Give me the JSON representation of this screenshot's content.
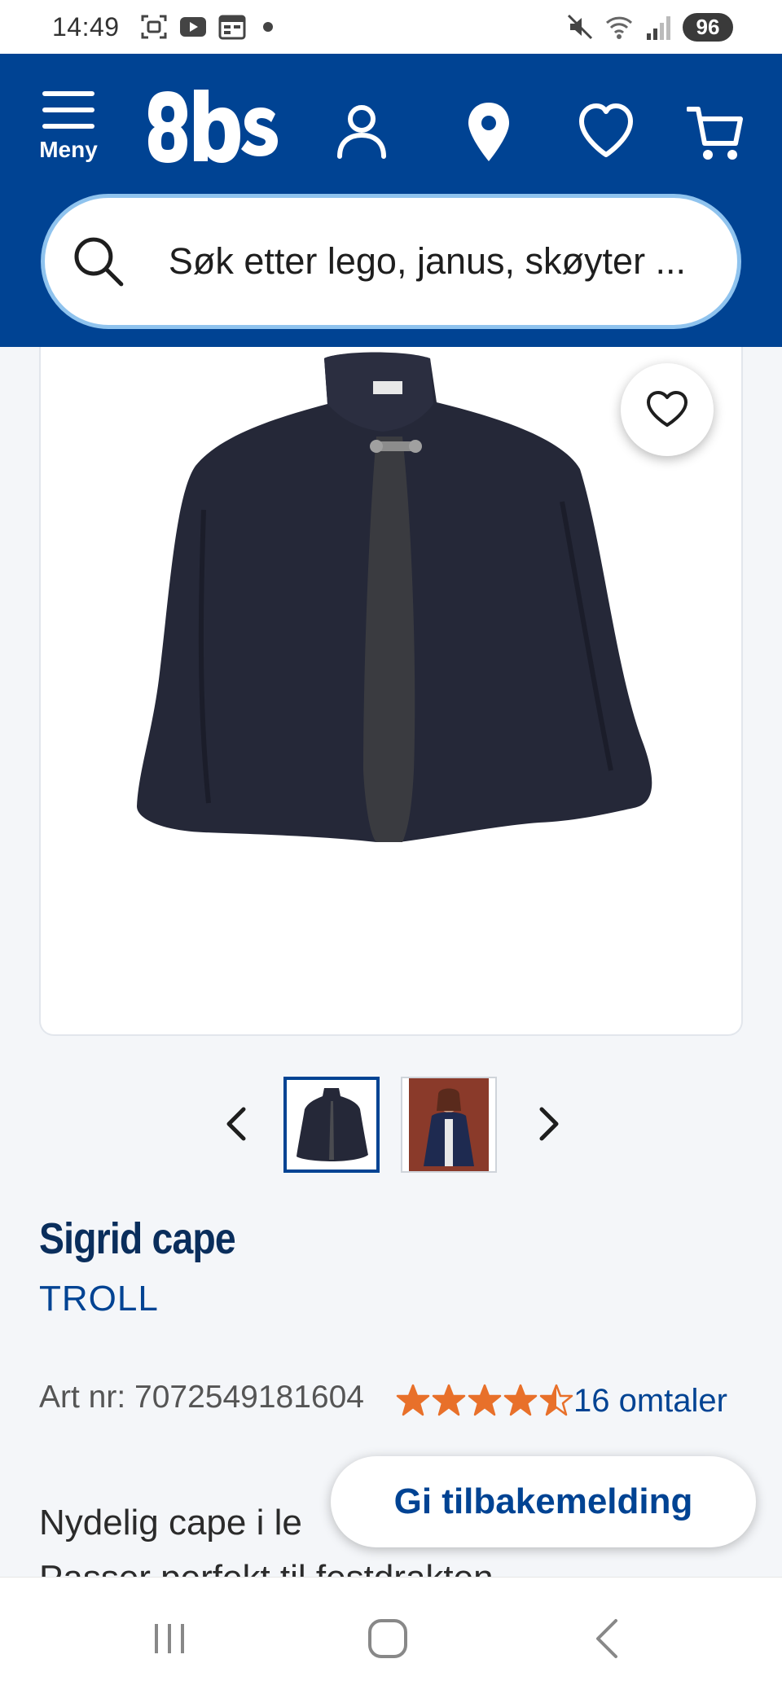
{
  "status_bar": {
    "time": "14:49",
    "battery": "96",
    "icons": [
      "screenshot-icon",
      "youtube-icon",
      "calendar-icon",
      "notification-dot",
      "mute-icon",
      "wifi-icon",
      "signal-icon"
    ]
  },
  "header": {
    "menu_label": "Meny",
    "logo_text": "Obs",
    "icons": [
      "user-icon",
      "location-icon",
      "heart-icon",
      "cart-icon"
    ],
    "brand_color": "#004393"
  },
  "search": {
    "placeholder": "Søk etter lego, janus, skøyter ..."
  },
  "product": {
    "image": "navy-cape-photo",
    "title": "Sigrid cape",
    "brand": "TROLL",
    "art_nr": "Art nr: 7072549181604",
    "rating": 4.5,
    "rating_max": 5,
    "reviews": "16 omtaler",
    "star_color": "#e8702a",
    "description": "Nydelig cape i le",
    "description_line2": "Passer perfekt til festdrakten. -",
    "thumbnails": [
      "cape-thumbnail",
      "model-wearing-cape-thumbnail"
    ],
    "active_thumbnail": 0
  },
  "feedback": {
    "label": "Gi tilbakemelding"
  },
  "navbar": {
    "icons": [
      "recent-apps-icon",
      "home-icon",
      "back-icon"
    ]
  }
}
